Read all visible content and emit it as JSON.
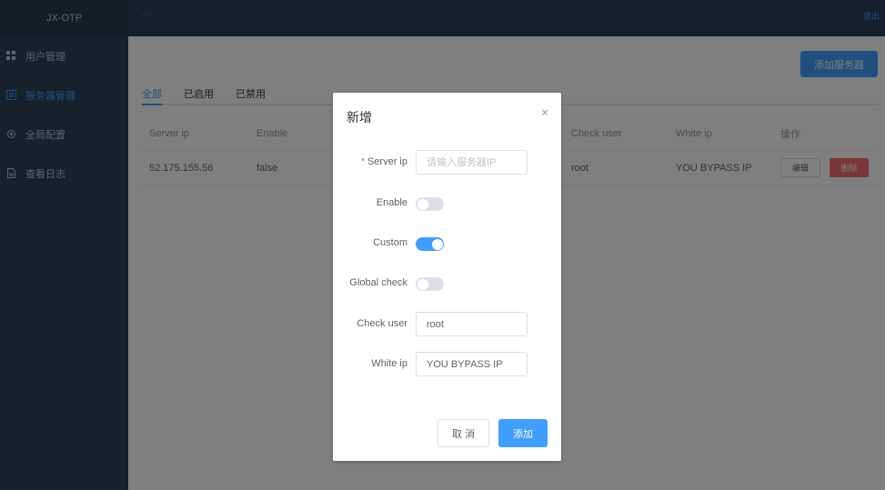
{
  "app": {
    "brand": "JX-OTP"
  },
  "header": {
    "hamburger": "···",
    "logout": "退出"
  },
  "sidebar": {
    "items": [
      {
        "label": "用户管理",
        "icon": "grid-icon"
      },
      {
        "label": "服务器管理",
        "icon": "list-icon",
        "active": true
      },
      {
        "label": "全局配置",
        "icon": "gear-icon"
      },
      {
        "label": "查看日志",
        "icon": "document-icon"
      }
    ]
  },
  "main": {
    "add_server_label": "添加服务器",
    "tabs": [
      {
        "label": "全部",
        "active": true
      },
      {
        "label": "已启用"
      },
      {
        "label": "已禁用"
      }
    ],
    "table": {
      "columns": [
        "Server ip",
        "Enable",
        "Check user",
        "White ip",
        "操作"
      ],
      "rows": [
        {
          "server_ip": "52.175.155.56",
          "enable": "false",
          "check_user": "root",
          "white_ip": "YOU BYPASS IP",
          "edit": "编辑",
          "delete": "删除"
        }
      ]
    }
  },
  "dialog": {
    "title": "新增",
    "close": "×",
    "fields": {
      "server_ip": {
        "label": "Server ip",
        "required": "*",
        "placeholder": "请输入服务器IP",
        "value": ""
      },
      "enable": {
        "label": "Enable",
        "on": false
      },
      "custom": {
        "label": "Custom",
        "on": true
      },
      "global_check": {
        "label": "Global check",
        "on": false
      },
      "check_user": {
        "label": "Check user",
        "value": "root"
      },
      "white_ip": {
        "label": "White ip",
        "value": "YOU BYPASS IP"
      }
    },
    "cancel_label": "取 消",
    "confirm_label": "添加"
  },
  "colors": {
    "accent": "#409eff",
    "danger": "#f56c6c",
    "sidebar_bg": "#304156"
  }
}
